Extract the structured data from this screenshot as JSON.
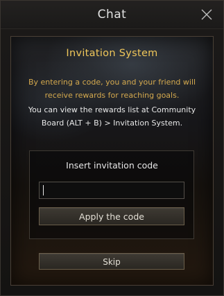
{
  "window": {
    "title": "Chat"
  },
  "invitation": {
    "heading": "Invitation System",
    "desc_gold_line1": "By entering a code, you and your friend will",
    "desc_gold_line2": "receive rewards for reaching goals.",
    "desc_white_line1": "You can view the rewards list at Community",
    "desc_white_line2": "Board (ALT + B) > Invitation System."
  },
  "code_form": {
    "title": "Insert invitation code",
    "input_value": "",
    "apply_label": "Apply the code"
  },
  "footer": {
    "skip_label": "Skip"
  },
  "icons": {
    "close": "close-icon"
  },
  "colors": {
    "heading": "#f0c75a",
    "gold_text": "#d4a94e",
    "body_text": "#e8e8e8"
  }
}
